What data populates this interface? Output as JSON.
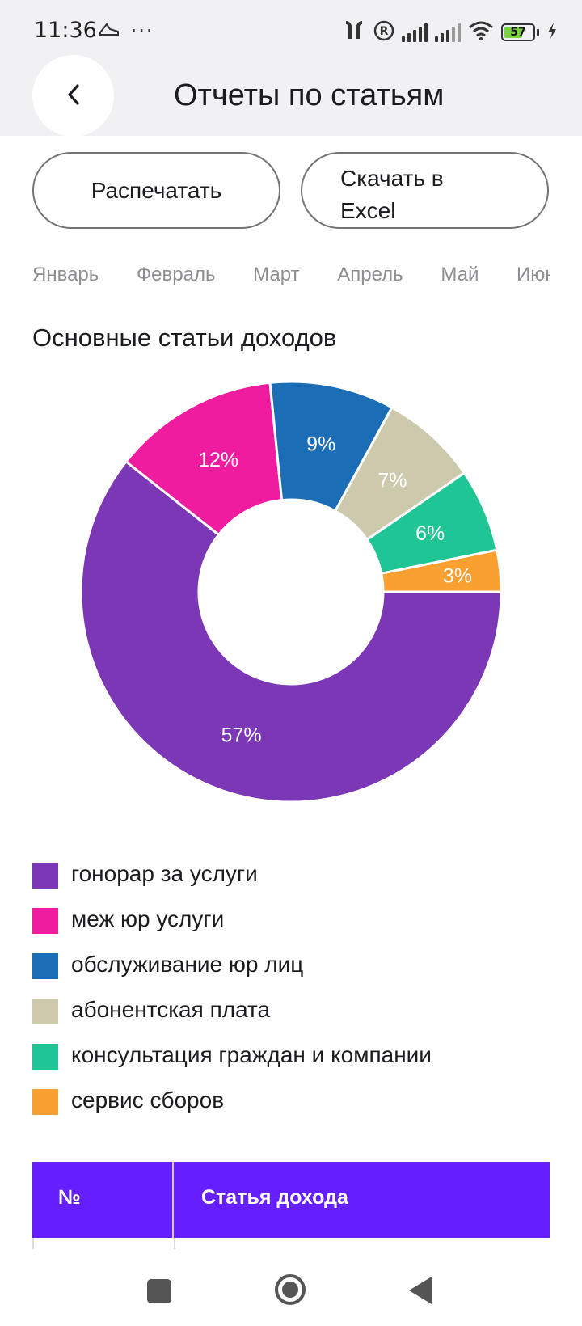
{
  "status_bar": {
    "time": "11:36",
    "left_icons": [
      "sneaker-icon",
      "more-dots-icon"
    ],
    "battery": "57",
    "right_icons": [
      "earbuds-icon",
      "registered-icon",
      "signal-icon",
      "signal-icon",
      "wifi-icon",
      "battery-icon",
      "charging-icon"
    ]
  },
  "app_bar": {
    "title": "Отчеты по статьям"
  },
  "actions": {
    "print_label": "Распечатать",
    "excel_label": "Скачать в\nExcel"
  },
  "months": [
    "Январь",
    "Февраль",
    "Март",
    "Апрель",
    "Май",
    "Июнь"
  ],
  "section": {
    "title": "Основные статьи доходов"
  },
  "chart_data": {
    "type": "pie",
    "donut": true,
    "categories": [
      "гонорар за услуги",
      "меж юр услуги",
      "обслуживание юр лиц",
      "абонентская плата",
      "консультация граждан и компании",
      "сервис сборов"
    ],
    "values": [
      57,
      12,
      9,
      7,
      6,
      3
    ],
    "labels": [
      "57%",
      "12%",
      "9%",
      "7%",
      "6%",
      "3%"
    ],
    "colors": [
      "#7b37b6",
      "#f01ca0",
      "#1b6db5",
      "#cdc9ad",
      "#20c596",
      "#f9a030"
    ]
  },
  "table": {
    "headers": [
      "№",
      "Статья дохода"
    ]
  },
  "nav": {
    "icons": [
      "recent-apps-icon",
      "home-icon",
      "back-icon"
    ]
  }
}
